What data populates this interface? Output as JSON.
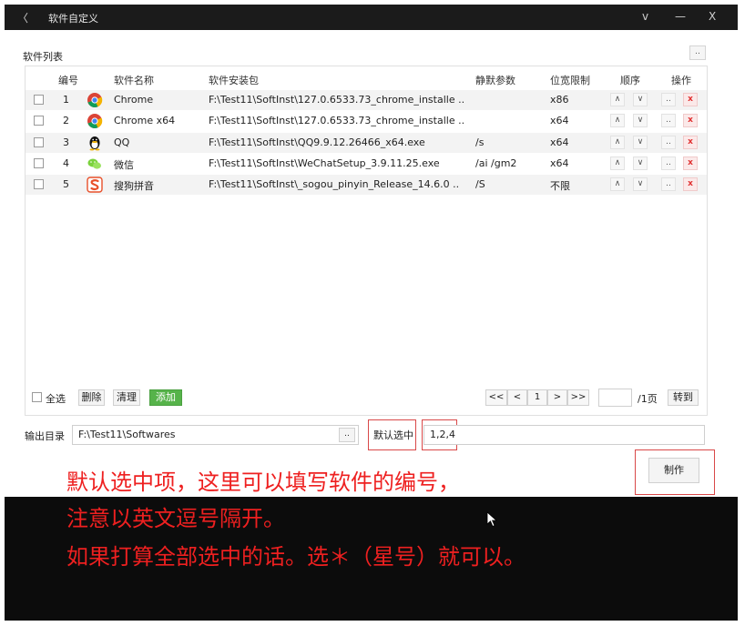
{
  "window": {
    "back": "〈",
    "title": "软件自定义",
    "btn_collapse": "v",
    "btn_minimize": "—",
    "btn_close": "X"
  },
  "section_title": "软件列表",
  "more_button": "..",
  "table": {
    "headers": [
      "编号",
      "软件名称",
      "软件安装包",
      "静默参数",
      "位宽限制",
      "顺序",
      "操作"
    ],
    "rows": [
      {
        "num": "1",
        "icon": "chrome-icon",
        "name": "Chrome",
        "package": "F:\\Test11\\SoftInst\\127.0.6533.73_chrome_installe ..",
        "params": "",
        "arch": "x86"
      },
      {
        "num": "2",
        "icon": "chrome-icon",
        "name": "Chrome x64",
        "package": "F:\\Test11\\SoftInst\\127.0.6533.73_chrome_installe ..",
        "params": "",
        "arch": "x64"
      },
      {
        "num": "3",
        "icon": "qq-penguin-icon",
        "name": "QQ",
        "package": "F:\\Test11\\SoftInst\\QQ9.9.12.26466_x64.exe",
        "params": "/s",
        "arch": "x64"
      },
      {
        "num": "4",
        "icon": "wechat-icon",
        "name": "微信",
        "package": "F:\\Test11\\SoftInst\\WeChatSetup_3.9.11.25.exe",
        "params": "/ai /gm2",
        "arch": "x64"
      },
      {
        "num": "5",
        "icon": "sogou-icon",
        "name": "搜狗拼音",
        "package": "F:\\Test11\\SoftInst\\_sogou_pinyin_Release_14.6.0 ..",
        "params": "/S",
        "arch": "不限"
      }
    ],
    "order_up": "∧",
    "order_down": "∨",
    "action_edit": "..",
    "action_delete": "x"
  },
  "footer": {
    "select_all": "全选",
    "delete": "删除",
    "clear": "清理",
    "add": "添加",
    "pager_first": "<<",
    "pager_prev": "<",
    "pager_current": "1",
    "pager_next": ">",
    "pager_last": ">>",
    "page_input": "",
    "page_total": "/1页",
    "goto": "转到"
  },
  "output": {
    "label": "输出目录",
    "path": "F:\\Test11\\Softwares",
    "browse": "..",
    "default_label": "默认选中",
    "default_value": "1,2,4"
  },
  "make_button": "制作",
  "captions": [
    "默认选中项，这里可以填写软件的编号，",
    "注意以英文逗号隔开。",
    "如果打算全部选中的话。选＊（星号）就可以。"
  ],
  "colors": {
    "accent_green": "#56b34a",
    "delete_red": "#e03030",
    "caption_red": "#ee2020",
    "highlight_box": "#d94848"
  }
}
